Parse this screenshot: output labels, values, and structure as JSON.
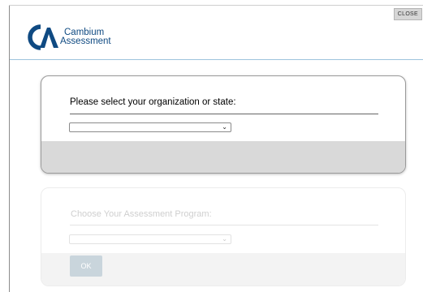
{
  "header": {
    "close_label": "CLOSE",
    "logo": {
      "line1": "Cambium",
      "line2": "Assessment",
      "brand_color": "#0f4a82"
    }
  },
  "organization_card": {
    "prompt": "Please select your organization or state:",
    "select": {
      "selected_value": "",
      "icon": "chevron-down-icon"
    }
  },
  "program_card": {
    "prompt": "Choose Your Assessment Program:",
    "select": {
      "selected_value": "",
      "icon": "chevron-down-icon"
    },
    "ok_label": "OK",
    "state": "disabled"
  }
}
